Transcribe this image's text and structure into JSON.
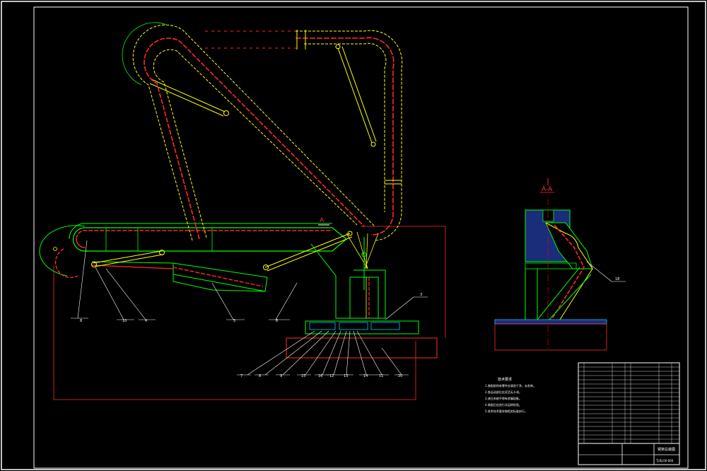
{
  "drawing": {
    "section_label": "A-A",
    "section_marks": [
      "A",
      "A"
    ],
    "part_callouts": [
      "8",
      "10",
      "4",
      "5",
      "6",
      "3",
      "7",
      "8",
      "9",
      "15",
      "16",
      "12",
      "13",
      "14",
      "11",
      "20"
    ],
    "section_view_callout": "18",
    "notes": {
      "title": "技术要求",
      "lines": [
        "1.装配前所有零件应清洗干净，去毛刺。",
        "2.各运动部位应灵活无卡滞。",
        "3.液压系统不得有渗漏现象。",
        "4.装配后应进行试运转检验。",
        "5.其余技术要求按相关标准执行。"
      ]
    },
    "title_block": {
      "drawing_name": "臂架总装图",
      "drawing_number": "TJ.BJ.00-000"
    },
    "colors": {
      "frame": "#ffffff",
      "body": "#00ff00",
      "pipe": "#ff2a2a",
      "hatch": "#ffff00",
      "center": "#ff0000",
      "cyan": "#00c8ff",
      "section_fill": "#1a2d7a"
    }
  }
}
